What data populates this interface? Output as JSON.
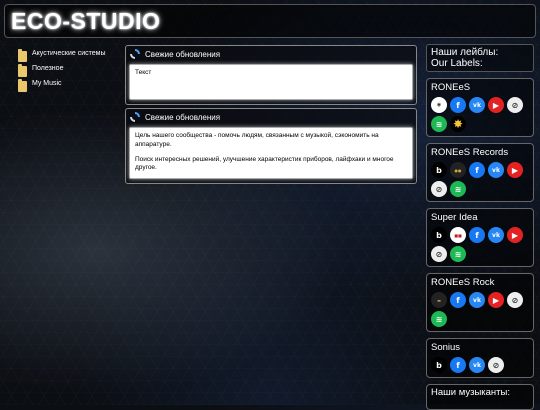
{
  "site": {
    "title": "ECO-STUDIO"
  },
  "nav": {
    "items": [
      {
        "label": "Акустические системы"
      },
      {
        "label": "Полезное"
      },
      {
        "label": "My Music"
      }
    ]
  },
  "panels": [
    {
      "title": "Свежие обновления",
      "lines": [
        "Текст"
      ]
    },
    {
      "title": "Свежие обновления",
      "lines": [
        "Цель нашего сообщества - помочь людям, связанным с музыкой, сэкономить на аппаратуре.",
        "Поиск интересных решений, улучшение характеристик приборов, лайфхаки и многое другое."
      ]
    }
  ],
  "sidebar": {
    "heading_line1": "Наши лейблы:",
    "heading_line2": "Our Labels:",
    "labels": [
      {
        "name": "RONEeS"
      },
      {
        "name": "RONEeS Records"
      },
      {
        "name": "Super Idea"
      },
      {
        "name": "RONEeS Rock"
      },
      {
        "name": "Sonius"
      }
    ],
    "next_heading": "Наши музыканты:"
  }
}
